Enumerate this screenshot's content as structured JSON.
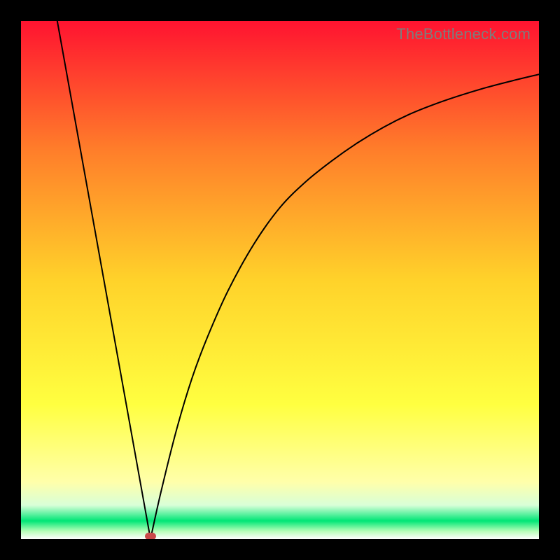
{
  "watermark": "TheBottleneck.com",
  "colors": {
    "top": "#ff1330",
    "mid_upper": "#ff7e2a",
    "mid": "#ffd22a",
    "mid_lower": "#ffff40",
    "pale_yellow": "#ffffaa",
    "pale_green": "#b8ffb8",
    "green": "#00e676",
    "bottom_fade": "#ffffff"
  },
  "chart_data": {
    "type": "line",
    "title": "",
    "xlabel": "",
    "ylabel": "",
    "xlim": [
      0,
      100
    ],
    "ylim": [
      0,
      100
    ],
    "marker": {
      "x": 25,
      "y": 0
    },
    "series": [
      {
        "name": "left-segment",
        "x": [
          7,
          25
        ],
        "y": [
          100,
          0
        ]
      },
      {
        "name": "right-segment",
        "x": [
          25,
          27,
          30,
          33,
          36,
          40,
          45,
          50,
          55,
          60,
          65,
          70,
          75,
          80,
          85,
          90,
          95,
          100
        ],
        "y": [
          0,
          9,
          21,
          31,
          39,
          48,
          57,
          64,
          69,
          73,
          76.5,
          79.5,
          82,
          84,
          85.7,
          87.2,
          88.5,
          89.7
        ]
      }
    ],
    "gradient_stops": [
      {
        "offset": 0.0,
        "color": "#ff1330"
      },
      {
        "offset": 0.25,
        "color": "#ff7e2a"
      },
      {
        "offset": 0.5,
        "color": "#ffd22a"
      },
      {
        "offset": 0.74,
        "color": "#ffff40"
      },
      {
        "offset": 0.89,
        "color": "#ffffaa"
      },
      {
        "offset": 0.935,
        "color": "#d8ffd8"
      },
      {
        "offset": 0.965,
        "color": "#00e676"
      },
      {
        "offset": 0.985,
        "color": "#b8ffb8"
      },
      {
        "offset": 1.0,
        "color": "#ffffff"
      }
    ]
  }
}
